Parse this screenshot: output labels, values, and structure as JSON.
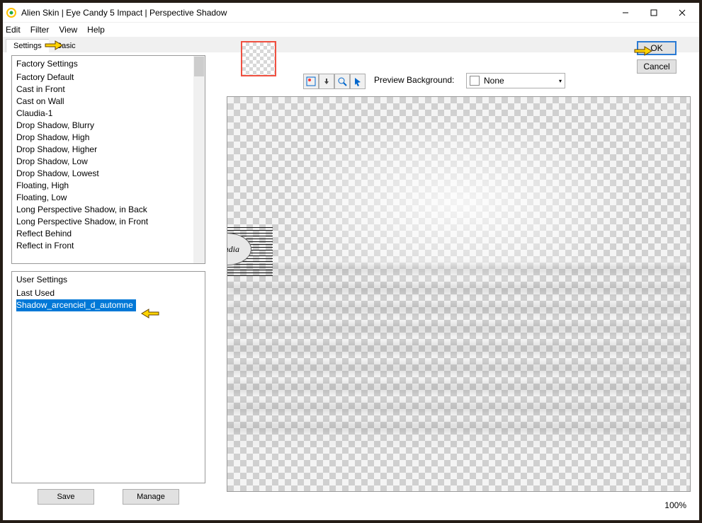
{
  "titlebar": {
    "title": "Alien Skin | Eye Candy 5 Impact | Perspective Shadow"
  },
  "menubar": {
    "edit": "Edit",
    "filter": "Filter",
    "view": "View",
    "help": "Help"
  },
  "tabs": {
    "settings": "Settings",
    "basic": "Basic"
  },
  "factory": {
    "header": "Factory Settings",
    "items": [
      "Factory Default",
      "Cast in Front",
      "Cast on Wall",
      "Claudia-1",
      "Drop Shadow, Blurry",
      "Drop Shadow, High",
      "Drop Shadow, Higher",
      "Drop Shadow, Low",
      "Drop Shadow, Lowest",
      "Floating, High",
      "Floating, Low",
      "Long Perspective Shadow, in Back",
      "Long Perspective Shadow, in Front",
      "Reflect Behind",
      "Reflect in Front"
    ]
  },
  "user": {
    "header": "User Settings",
    "items": [
      "Last Used",
      "Shadow_arcenciel_d_automne"
    ],
    "selected_index": 1
  },
  "buttons": {
    "save": "Save",
    "manage": "Manage",
    "ok": "OK",
    "cancel": "Cancel"
  },
  "preview": {
    "label": "Preview Background:",
    "bg": "None"
  },
  "zoom": "100%",
  "watermark": "claudia"
}
